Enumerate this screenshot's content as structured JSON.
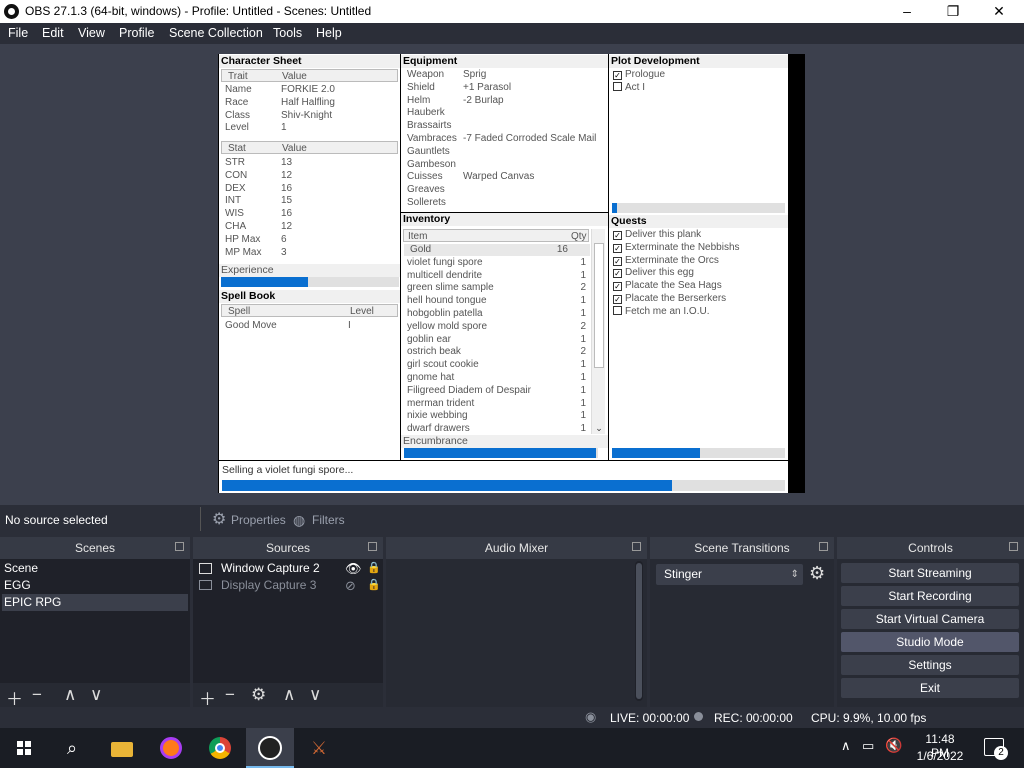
{
  "window": {
    "title": "OBS 27.1.3 (64-bit, windows) - Profile: Untitled - Scenes: Untitled",
    "minimize": "–",
    "maximize": "❐",
    "close": "✕"
  },
  "menu": [
    "File",
    "Edit",
    "View",
    "Profile",
    "Scene Collection",
    "Tools",
    "Help"
  ],
  "game": {
    "character_sheet": {
      "title": "Character Sheet",
      "trait_header": "Trait",
      "value_header": "Value",
      "traits": [
        {
          "k": "Name",
          "v": "FORKIE 2.0"
        },
        {
          "k": "Race",
          "v": "Half Halfling"
        },
        {
          "k": "Class",
          "v": "Shiv-Knight"
        },
        {
          "k": "Level",
          "v": "1"
        }
      ],
      "stat_header": "Stat",
      "stat_value_header": "Value",
      "stats": [
        {
          "k": "STR",
          "v": "13"
        },
        {
          "k": "CON",
          "v": "12"
        },
        {
          "k": "DEX",
          "v": "16"
        },
        {
          "k": "INT",
          "v": "15"
        },
        {
          "k": "WIS",
          "v": "16"
        },
        {
          "k": "CHA",
          "v": "12"
        },
        {
          "k": "HP Max",
          "v": "6"
        },
        {
          "k": "MP Max",
          "v": "3"
        }
      ],
      "experience_label": "Experience",
      "experience_progress": 0.49
    },
    "spell_book": {
      "title": "Spell Book",
      "spell_header": "Spell",
      "level_header": "Level",
      "spells": [
        {
          "k": "Good Move",
          "v": "I"
        }
      ]
    },
    "equipment": {
      "title": "Equipment",
      "items": [
        {
          "k": "Weapon",
          "v": "Sprig"
        },
        {
          "k": "Shield",
          "v": "+1 Parasol"
        },
        {
          "k": "Helm",
          "v": "-2 Burlap"
        },
        {
          "k": "Hauberk",
          "v": ""
        },
        {
          "k": "Brassairts",
          "v": ""
        },
        {
          "k": "Vambraces",
          "v": "-7 Faded Corroded Scale Mail"
        },
        {
          "k": "Gauntlets",
          "v": ""
        },
        {
          "k": "Gambeson",
          "v": ""
        },
        {
          "k": "Cuisses",
          "v": "Warped Canvas"
        },
        {
          "k": "Greaves",
          "v": ""
        },
        {
          "k": "Sollerets",
          "v": ""
        }
      ]
    },
    "inventory": {
      "title": "Inventory",
      "item_header": "Item",
      "qty_header": "Qty",
      "items": [
        {
          "k": "Gold",
          "v": "16"
        },
        {
          "k": "violet fungi spore",
          "v": "1"
        },
        {
          "k": "multicell dendrite",
          "v": "1"
        },
        {
          "k": "green slime sample",
          "v": "2"
        },
        {
          "k": "hell hound tongue",
          "v": "1"
        },
        {
          "k": "hobgoblin patella",
          "v": "1"
        },
        {
          "k": "yellow mold spore",
          "v": "2"
        },
        {
          "k": "goblin ear",
          "v": "1"
        },
        {
          "k": "ostrich beak",
          "v": "2"
        },
        {
          "k": "girl scout cookie",
          "v": "1"
        },
        {
          "k": "gnome hat",
          "v": "1"
        },
        {
          "k": "Filigreed Diadem of Despair",
          "v": "1"
        },
        {
          "k": "merman trident",
          "v": "1"
        },
        {
          "k": "nixie webbing",
          "v": "1"
        },
        {
          "k": "dwarf drawers",
          "v": "1"
        }
      ],
      "encumbrance_label": "Encumbrance",
      "encumbrance_progress": 0.99
    },
    "plot": {
      "title": "Plot Development",
      "items": [
        {
          "label": "Prologue",
          "checked": true
        },
        {
          "label": "Act I",
          "checked": false
        }
      ],
      "progress": 0.03
    },
    "quests": {
      "title": "Quests",
      "items": [
        {
          "label": "Deliver this plank",
          "checked": true
        },
        {
          "label": "Exterminate the Nebbishs",
          "checked": true
        },
        {
          "label": "Exterminate the Orcs",
          "checked": true
        },
        {
          "label": "Deliver this egg",
          "checked": true
        },
        {
          "label": "Placate the Sea Hags",
          "checked": true
        },
        {
          "label": "Placate the Berserkers",
          "checked": true
        },
        {
          "label": "Fetch me an I.O.U.",
          "checked": false
        }
      ],
      "progress": 0.51
    },
    "status": {
      "text": "Selling a violet fungi spore...",
      "progress": 0.8
    }
  },
  "source_toolbar": {
    "no_source": "No source selected",
    "properties": "Properties",
    "filters": "Filters"
  },
  "scenes": {
    "title": "Scenes",
    "items": [
      "Scene",
      "EGG",
      "EPIC RPG"
    ],
    "selected": 2
  },
  "sources": {
    "title": "Sources",
    "items": [
      {
        "label": "Window Capture 2",
        "visible": true
      },
      {
        "label": "Display Capture 3",
        "visible": false
      }
    ]
  },
  "audio_mixer": {
    "title": "Audio Mixer"
  },
  "transitions": {
    "title": "Scene Transitions",
    "selected": "Stinger"
  },
  "controls": {
    "title": "Controls",
    "buttons": [
      "Start Streaming",
      "Start Recording",
      "Start Virtual Camera",
      "Studio Mode",
      "Settings",
      "Exit"
    ]
  },
  "statusbar": {
    "live": "LIVE: 00:00:00",
    "rec": "REC: 00:00:00",
    "cpu": "CPU: 9.9%, 10.00 fps"
  },
  "taskbar": {
    "time": "11:48 PM",
    "date": "1/6/2022",
    "notifications": "2"
  }
}
